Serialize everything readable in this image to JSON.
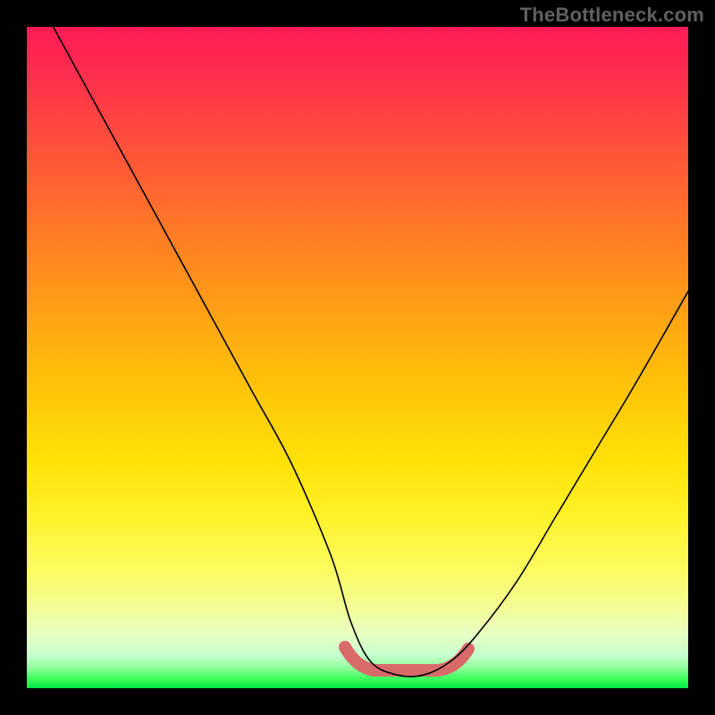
{
  "watermark": "TheBottleneck.com",
  "chart_data": {
    "type": "line",
    "title": "",
    "xlabel": "",
    "ylabel": "",
    "xlim": [
      0,
      100
    ],
    "ylim": [
      0,
      100
    ],
    "grid": false,
    "legend": false,
    "background_gradient": {
      "orientation": "vertical",
      "stops": [
        {
          "pos": 0,
          "color": "#ff1a56"
        },
        {
          "pos": 16,
          "color": "#ff4a3e"
        },
        {
          "pos": 36,
          "color": "#ff8a1e"
        },
        {
          "pos": 56,
          "color": "#ffc808"
        },
        {
          "pos": 74,
          "color": "#fff22a"
        },
        {
          "pos": 88,
          "color": "#f4fd98"
        },
        {
          "pos": 97,
          "color": "#8fff9a"
        },
        {
          "pos": 100,
          "color": "#00e846"
        }
      ]
    },
    "series": [
      {
        "name": "bottleneck-curve",
        "x": [
          4,
          10,
          16,
          22,
          28,
          34,
          40,
          46,
          49,
          52,
          56,
          60,
          64,
          68,
          74,
          80,
          86,
          92,
          100
        ],
        "y": [
          100,
          89,
          78,
          67,
          56,
          45,
          34,
          20,
          10,
          4,
          2,
          2,
          4,
          8,
          16,
          26,
          36,
          46,
          60
        ],
        "stroke": "#000000",
        "stroke_width": 1.6
      }
    ],
    "highlight": {
      "name": "emphasized-minimum",
      "x_range": [
        48,
        66
      ],
      "y_approx": 3,
      "stroke": "#d96a6a",
      "stroke_width": 14
    }
  }
}
